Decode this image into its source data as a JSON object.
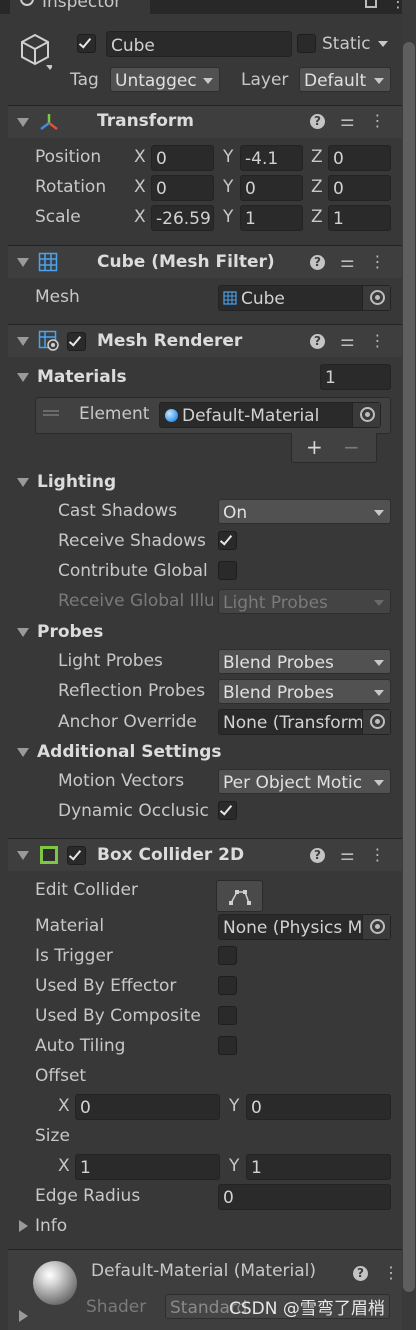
{
  "tab": {
    "title": "Inspector"
  },
  "object": {
    "name": "Cube",
    "static_label": "Static",
    "tag_label": "Tag",
    "tag_value": "Untaggec",
    "layer_label": "Layer",
    "layer_value": "Default"
  },
  "transform": {
    "title": "Transform",
    "position": {
      "label": "Position",
      "x": "0",
      "y": "-4.1",
      "z": "0"
    },
    "rotation": {
      "label": "Rotation",
      "x": "0",
      "y": "0",
      "z": "0"
    },
    "scale": {
      "label": "Scale",
      "x": "-26.59",
      "y": "1",
      "z": "1"
    },
    "axis_x": "X",
    "axis_y": "Y",
    "axis_z": "Z"
  },
  "mesh_filter": {
    "title": "Cube (Mesh Filter)",
    "mesh_label": "Mesh",
    "mesh_value": "Cube"
  },
  "mesh_renderer": {
    "title": "Mesh Renderer",
    "materials_label": "Materials",
    "materials_count": "1",
    "element_label": "Element",
    "element_value": "Default-Material",
    "plus": "+",
    "minus": "−",
    "lighting_label": "Lighting",
    "cast_shadows_label": "Cast Shadows",
    "cast_shadows_value": "On",
    "receive_shadows_label": "Receive Shadows",
    "contribute_gi_label": "Contribute Global",
    "receive_gi_label": "Receive Global Illu",
    "receive_gi_value": "Light Probes",
    "probes_label": "Probes",
    "light_probes_label": "Light Probes",
    "light_probes_value": "Blend Probes",
    "reflection_probes_label": "Reflection Probes",
    "reflection_probes_value": "Blend Probes",
    "anchor_override_label": "Anchor Override",
    "anchor_override_value": "None (Transform",
    "additional_label": "Additional Settings",
    "motion_vectors_label": "Motion Vectors",
    "motion_vectors_value": "Per Object Motic",
    "dynamic_occlusion_label": "Dynamic Occlusic"
  },
  "box_collider": {
    "title": "Box Collider 2D",
    "edit_collider_label": "Edit Collider",
    "material_label": "Material",
    "material_value": "None (Physics M",
    "is_trigger_label": "Is Trigger",
    "used_by_effector_label": "Used By Effector",
    "used_by_composite_label": "Used By Composite",
    "auto_tiling_label": "Auto Tiling",
    "offset_label": "Offset",
    "offset_x": "0",
    "offset_y": "0",
    "size_label": "Size",
    "size_x": "1",
    "size_y": "1",
    "edge_radius_label": "Edge Radius",
    "edge_radius_value": "0",
    "info_label": "Info",
    "axis_x": "X",
    "axis_y": "Y"
  },
  "material_footer": {
    "title": "Default-Material (Material)",
    "shader_label": "Shader",
    "shader_value": "Standard"
  },
  "watermark": "CSDN @雪弯了眉梢",
  "colors": {
    "background": "#383838",
    "header": "#3e3e3e",
    "field": "#2a2a2a",
    "dropdown": "#515151",
    "accent_green": "#7ec742"
  }
}
